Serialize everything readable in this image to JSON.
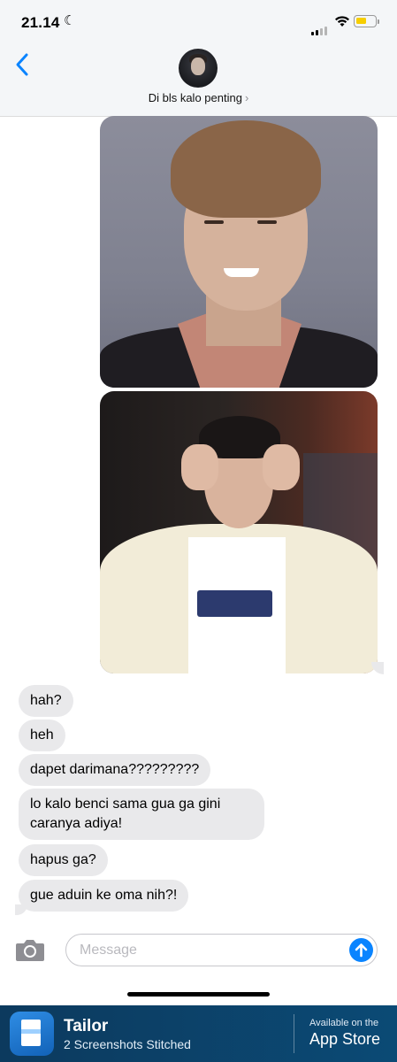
{
  "status_bar": {
    "time": "21.14",
    "battery_color": "#f7ce00"
  },
  "header": {
    "contact_name": "Di bls kalo penting",
    "chevron": "›"
  },
  "messages": [
    {
      "text": "hah?"
    },
    {
      "text": "heh"
    },
    {
      "text": "dapet darimana?????????"
    },
    {
      "text": "lo kalo benci sama gua ga gini caranya adiya!"
    },
    {
      "text": "hapus ga?"
    },
    {
      "text": "gue aduin ke oma nih?!"
    }
  ],
  "composer": {
    "placeholder": "Message"
  },
  "banner": {
    "app_name": "Tailor",
    "subtitle": "2 Screenshots Stitched",
    "available": "Available on the",
    "store": "App Store"
  },
  "colors": {
    "accent": "#0a84ff",
    "bubble": "#e9e9eb",
    "banner": "#0b4a75"
  }
}
